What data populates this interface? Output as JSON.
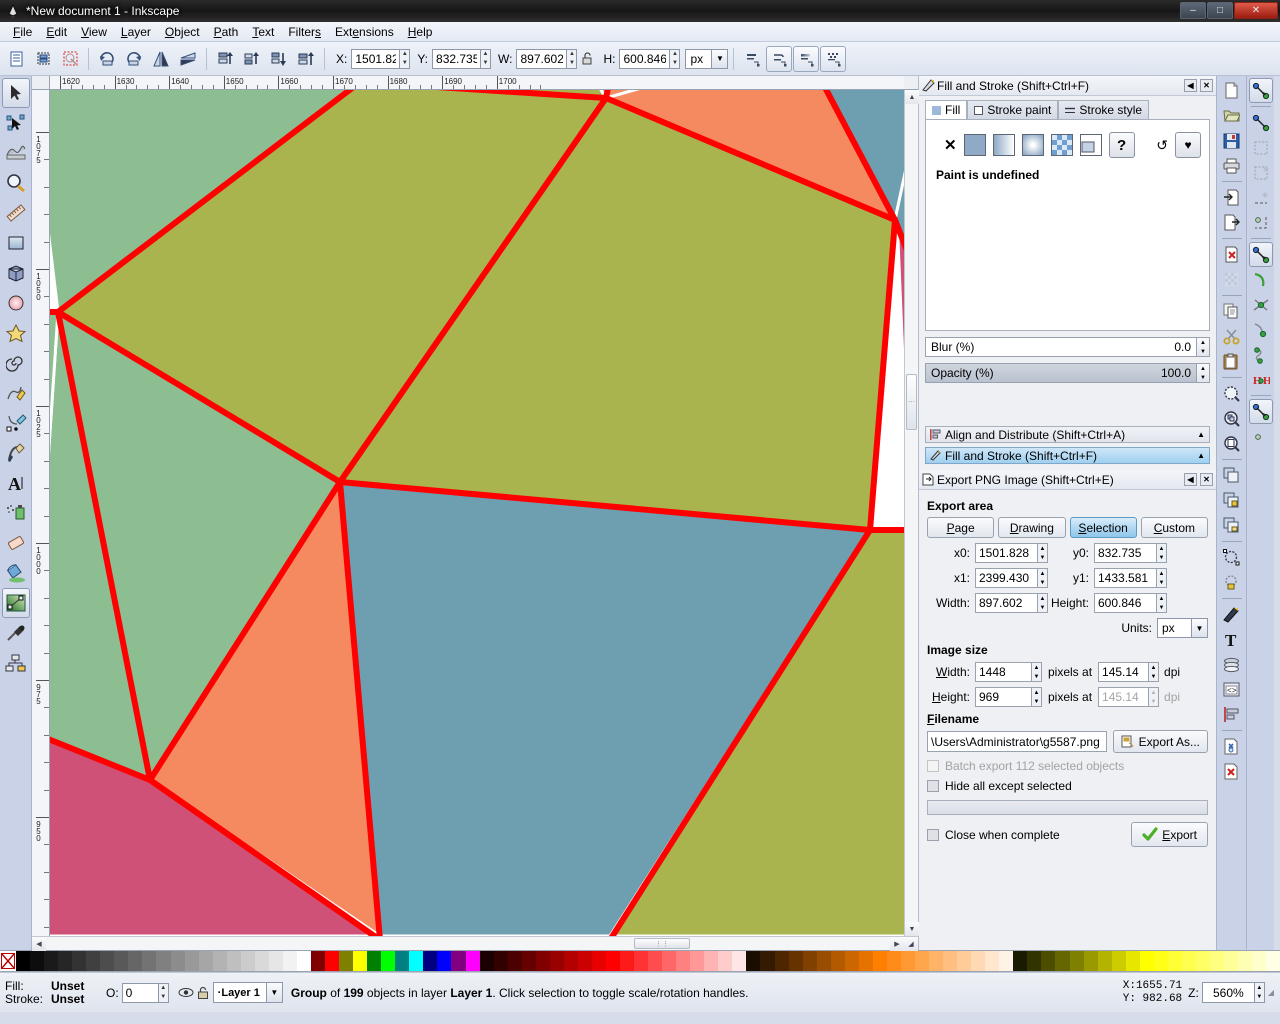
{
  "window": {
    "title": "*New document 1 - Inkscape",
    "app_icon": "inkscape-icon",
    "minimize": "–",
    "maximize": "□",
    "close": "✕"
  },
  "menubar": {
    "items": [
      {
        "label": "File"
      },
      {
        "label": "Edit"
      },
      {
        "label": "View"
      },
      {
        "label": "Layer"
      },
      {
        "label": "Object"
      },
      {
        "label": "Path"
      },
      {
        "label": "Text"
      },
      {
        "label": "Filters"
      },
      {
        "label": "Extensions"
      },
      {
        "label": "Help"
      }
    ]
  },
  "toolbar": {
    "x_label": "X:",
    "x_value": "1501.82",
    "y_label": "Y:",
    "y_value": "832.735",
    "w_label": "W:",
    "w_value": "897.602",
    "h_label": "H:",
    "h_value": "600.846",
    "units_value": "px",
    "lock_icon": "lock-open-icon"
  },
  "toolbox": {
    "items": [
      {
        "name": "selector-tool",
        "active": true
      },
      {
        "name": "node-tool",
        "active": false
      },
      {
        "name": "tweak-tool",
        "active": false
      },
      {
        "name": "zoom-tool",
        "active": false
      },
      {
        "name": "measure-tool",
        "active": false
      },
      {
        "name": "rectangle-tool",
        "active": false
      },
      {
        "name": "3dbox-tool",
        "active": false
      },
      {
        "name": "ellipse-tool",
        "active": false
      },
      {
        "name": "star-tool",
        "active": false
      },
      {
        "name": "spiral-tool",
        "active": false
      },
      {
        "name": "pencil-tool",
        "active": false
      },
      {
        "name": "bezier-tool",
        "active": false
      },
      {
        "name": "calligraphy-tool",
        "active": false
      },
      {
        "name": "text-tool",
        "active": false
      },
      {
        "name": "spray-tool",
        "active": false
      },
      {
        "name": "eraser-tool",
        "active": false
      },
      {
        "name": "bucket-fill-tool",
        "active": false
      },
      {
        "name": "gradient-tool",
        "active": true
      },
      {
        "name": "dropper-tool",
        "active": false
      },
      {
        "name": "connector-tool",
        "active": false
      }
    ]
  },
  "rulers": {
    "horizontal": [
      "1620",
      "1630",
      "1640",
      "1650",
      "1660",
      "1670",
      "1680",
      "1690",
      "1700"
    ],
    "vertical": [
      "1075",
      "1050",
      "1025",
      "1000",
      "975",
      "950"
    ]
  },
  "canvas": {
    "artwork_name": "low-poly-triangle-illustration",
    "stroke_color": "#ff0000",
    "palette": [
      "#8cbe92",
      "#a9b44e",
      "#f58a61",
      "#6d9fb1",
      "#cf5178",
      "#ffffff"
    ]
  },
  "fill_and_stroke": {
    "title": "Fill and Stroke (Shift+Ctrl+F)",
    "icon": "fill-stroke-icon",
    "collapse_icon": "◀",
    "close_icon": "✕",
    "tabs": [
      {
        "label": "Fill",
        "icon": "fill-swatch-icon",
        "selected": true
      },
      {
        "label": "Stroke paint",
        "icon": "stroke-paint-icon",
        "selected": false
      },
      {
        "label": "Stroke style",
        "icon": "stroke-style-icon",
        "selected": false
      }
    ],
    "paint_buttons": [
      {
        "name": "no-paint-button",
        "glyph": "✕"
      },
      {
        "name": "flat-color-button",
        "glyph": ""
      },
      {
        "name": "linear-gradient-button",
        "glyph": ""
      },
      {
        "name": "radial-gradient-button",
        "glyph": ""
      },
      {
        "name": "pattern-button",
        "glyph": ""
      },
      {
        "name": "swatch-button",
        "glyph": ""
      },
      {
        "name": "unknown-paint-button",
        "glyph": "?"
      }
    ],
    "extra_buttons": [
      {
        "name": "fill-rule-nonzero-button",
        "glyph": "↺"
      },
      {
        "name": "fill-rule-evenodd-button",
        "glyph": "♥"
      }
    ],
    "status_text": "Paint is undefined",
    "blur_label": "Blur (%)",
    "blur_value": "0.0",
    "opacity_label": "Opacity (%)",
    "opacity_value": "100.0"
  },
  "dialog_bars": [
    {
      "label": "Align and Distribute (Shift+Ctrl+A)",
      "icon": "align-icon",
      "selected": false,
      "chevron": "▲"
    },
    {
      "label": "Fill and Stroke (Shift+Ctrl+F)",
      "icon": "fill-stroke-icon",
      "selected": true,
      "chevron": "▲"
    }
  ],
  "export_png": {
    "title": "Export PNG Image (Shift+Ctrl+E)",
    "icon": "export-png-icon",
    "collapse_icon": "◀",
    "close_icon": "✕",
    "export_area_label": "Export area",
    "area_buttons": [
      {
        "label": "Page",
        "selected": false
      },
      {
        "label": "Drawing",
        "selected": false
      },
      {
        "label": "Selection",
        "selected": true
      },
      {
        "label": "Custom",
        "selected": false
      }
    ],
    "x0_label": "x0:",
    "x0_value": "1501.828",
    "y0_label": "y0:",
    "y0_value": "832.735",
    "x1_label": "x1:",
    "x1_value": "2399.430",
    "y1_label": "y1:",
    "y1_value": "1433.581",
    "width_label": "Width:",
    "width_value": "897.602",
    "height_label": "Height:",
    "height_value": "600.846",
    "units_label": "Units:",
    "units_value": "px",
    "image_size_label": "Image size",
    "img_width_label": "Width:",
    "img_width_value": "1448",
    "img_height_label": "Height:",
    "img_height_value": "969",
    "pixels_at_label": "pixels at",
    "dpi_label": "dpi",
    "dpi_width_value": "145.14",
    "dpi_height_value": "145.14",
    "filename_label": "Filename",
    "filename_value": "\\Users\\Administrator\\g5587.png",
    "export_as_label": "Export As...",
    "batch_label": "Batch export 112 selected objects",
    "hide_all_label": "Hide all except selected",
    "close_when_complete_label": "Close when complete",
    "export_label": "Export"
  },
  "command_bar": {
    "items": [
      {
        "name": "new-document-icon"
      },
      {
        "name": "open-document-icon"
      },
      {
        "name": "save-document-icon"
      },
      {
        "name": "print-icon"
      },
      {
        "sep": true
      },
      {
        "name": "import-icon"
      },
      {
        "name": "export-icon"
      },
      {
        "sep": true
      },
      {
        "name": "undo-icon"
      },
      {
        "name": "redo-icon"
      },
      {
        "sep": true
      },
      {
        "name": "copy-icon"
      },
      {
        "name": "cut-icon"
      },
      {
        "name": "paste-icon"
      },
      {
        "sep": true
      },
      {
        "name": "zoom-selection-icon"
      },
      {
        "name": "zoom-drawing-icon"
      },
      {
        "name": "zoom-page-icon"
      },
      {
        "sep": true
      },
      {
        "name": "duplicate-icon"
      },
      {
        "name": "group-icon"
      },
      {
        "name": "ungroup-icon"
      },
      {
        "sep": true
      },
      {
        "name": "object-to-path-icon"
      },
      {
        "name": "stroke-to-path-icon"
      },
      {
        "sep": true
      },
      {
        "name": "fill-stroke-dialog-icon"
      },
      {
        "name": "text-dialog-icon"
      },
      {
        "name": "layers-dialog-icon"
      },
      {
        "name": "xml-editor-icon"
      },
      {
        "name": "align-dialog-icon"
      },
      {
        "sep": true
      },
      {
        "name": "preferences-icon"
      },
      {
        "name": "document-properties-icon"
      }
    ]
  },
  "snap_bar": {
    "items": [
      {
        "name": "enable-snapping-icon",
        "on": true
      },
      {
        "sep": true
      },
      {
        "name": "snap-bounding-box-icon",
        "on": false
      },
      {
        "name": "snap-bbox-edge-icon",
        "on": false
      },
      {
        "name": "snap-bbox-corner-icon",
        "on": false
      },
      {
        "name": "snap-bbox-edge-midpoint-icon",
        "on": false
      },
      {
        "name": "snap-bbox-center-icon",
        "on": false
      },
      {
        "sep": true
      },
      {
        "name": "snap-nodes-icon",
        "on": true
      },
      {
        "name": "snap-path-icon",
        "on": false
      },
      {
        "name": "snap-path-intersection-icon",
        "on": false
      },
      {
        "name": "snap-cusp-node-icon",
        "on": false
      },
      {
        "name": "snap-smooth-node-icon",
        "on": false
      },
      {
        "name": "snap-midpoint-icon",
        "on": false
      },
      {
        "sep": true
      },
      {
        "name": "snap-others-icon",
        "on": true
      },
      {
        "name": "snap-object-center-icon",
        "on": false
      }
    ]
  },
  "palette": {
    "colors": [
      "#000000",
      "#0d0d0d",
      "#1a1a1a",
      "#262626",
      "#333333",
      "#404040",
      "#4d4d4d",
      "#595959",
      "#666666",
      "#737373",
      "#808080",
      "#8c8c8c",
      "#999999",
      "#a6a6a6",
      "#b3b3b3",
      "#bfbfbf",
      "#cccccc",
      "#d9d9d9",
      "#e6e6e6",
      "#f2f2f2",
      "#ffffff",
      "#800000",
      "#ff0000",
      "#808000",
      "#ffff00",
      "#008000",
      "#00ff00",
      "#008080",
      "#00ffff",
      "#000080",
      "#0000ff",
      "#800080",
      "#ff00ff",
      "#1a0000",
      "#330000",
      "#4d0000",
      "#660000",
      "#800000",
      "#990000",
      "#b30000",
      "#cc0000",
      "#e60000",
      "#ff0000",
      "#ff1a1a",
      "#ff3333",
      "#ff4d4d",
      "#ff6666",
      "#ff8080",
      "#ff9999",
      "#ffb3b3",
      "#ffcccc",
      "#ffe6e6",
      "#1a0d00",
      "#331a00",
      "#4d2600",
      "#663300",
      "#804000",
      "#994d00",
      "#b35900",
      "#cc6600",
      "#e67300",
      "#ff8000",
      "#ff8c1a",
      "#ff9933",
      "#ffa64d",
      "#ffb366",
      "#ffbf80",
      "#ffcc99",
      "#ffd9b3",
      "#ffe6cc",
      "#fff2e6",
      "#1a1a00",
      "#333300",
      "#4d4d00",
      "#666600",
      "#808000",
      "#999900",
      "#b3b300",
      "#cccc00",
      "#e6e600",
      "#ffff00",
      "#ffff1a",
      "#ffff33",
      "#ffff4d",
      "#ffff66",
      "#ffff80",
      "#ffff99",
      "#ffffb3",
      "#ffffcc",
      "#ffffe6"
    ],
    "none_swatch": "no-color-swatch"
  },
  "status_bar": {
    "fill_label": "Fill:",
    "fill_value": "Unset",
    "stroke_label": "Stroke:",
    "stroke_value": "Unset",
    "opacity_label": "O:",
    "opacity_value": "0",
    "visibility_icon": "eye-icon",
    "lock_icon": "lock-icon",
    "layer_value": "Layer 1",
    "message_prefix": "Group",
    "message_mid": " of ",
    "message_count": "199",
    "message_suffix": " objects in layer ",
    "message_layer": "Layer 1",
    "message_tail": ". Click selection to toggle scale/rotation handles.",
    "x_label": "X:",
    "x_value": "1655.71",
    "y_label": "Y:",
    "y_value": " 982.68",
    "zoom_label": "Z:",
    "zoom_value": "560%"
  }
}
